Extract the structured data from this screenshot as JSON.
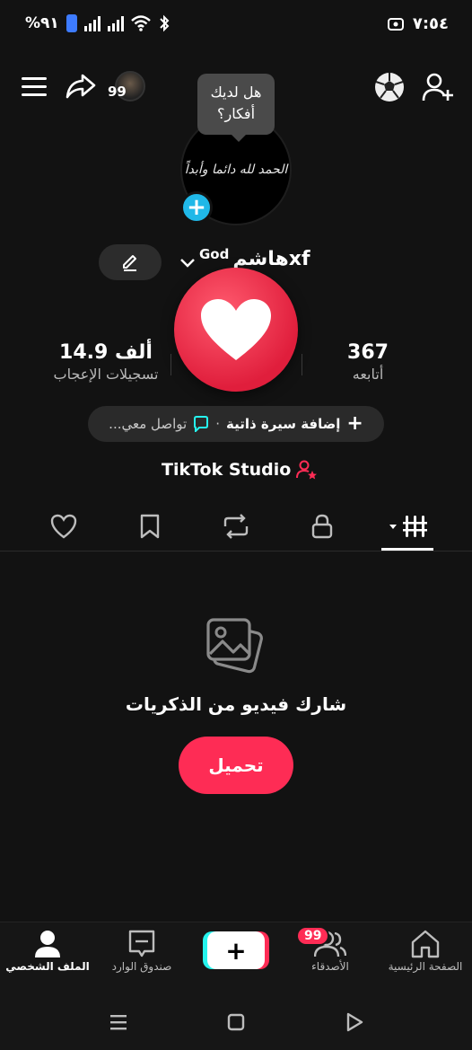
{
  "status_bar": {
    "battery_text": "%٩١",
    "time": "٧:٥٤"
  },
  "top_nav": {
    "avatar_badge": "99"
  },
  "profile": {
    "tooltip": "هل لديك أفكار؟",
    "avatar_text": "الحمد لله دائما وأبداً",
    "username": "هاشمxf",
    "username_sup": "God"
  },
  "stats": {
    "likes_value": "14.9 ألف",
    "likes_label": "تسجيلات الإعجاب",
    "followers_value": "367",
    "followers_label": "أتابعه"
  },
  "bio": {
    "add_bio": "إضافة سيرة ذاتية",
    "separator": "·",
    "contact": "تواصل معي..."
  },
  "studio": {
    "label": "TikTok Studio"
  },
  "empty_state": {
    "title": "شارك فيديو من الذكريات",
    "upload_label": "تحميل"
  },
  "bottom_nav": {
    "profile": "الملف الشخصي",
    "inbox": "صندوق الوارد",
    "friends": "الأصدقاء",
    "friends_badge": "99",
    "home": "الصفحة الرئيسية"
  },
  "colors": {
    "accent_red": "#fe2c55",
    "accent_cyan": "#25f4ee",
    "heart_red": "#e01e3c",
    "avatar_plus_blue": "#20b8e8"
  }
}
